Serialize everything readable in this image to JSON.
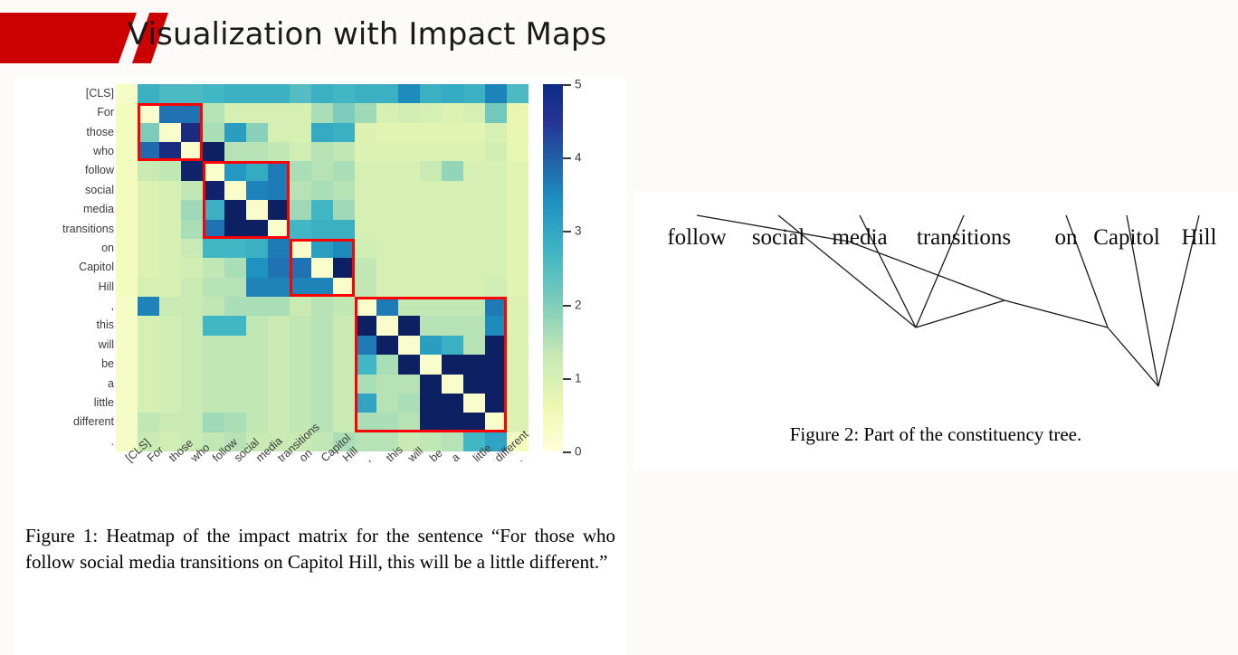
{
  "header": {
    "title": "Visualization with Impact Maps",
    "accent_color": "#cc0000"
  },
  "figure1": {
    "caption": "Figure 1: Heatmap of the impact matrix for the sentence “For those who follow social media transitions on Capitol Hill, this will be a little different.”",
    "colorbar": {
      "ticks": [
        "0",
        "1",
        "2",
        "3",
        "4",
        "5"
      ],
      "min": 0,
      "max": 5,
      "colormap": "YlGnBu"
    }
  },
  "figure2": {
    "caption": "Figure 2: Part of the constituency tree.",
    "leaves": [
      "follow",
      "social",
      "media",
      "transitions",
      "on",
      "Capitol",
      "Hill"
    ]
  },
  "chart_data": {
    "type": "heatmap",
    "title": "",
    "xlabel": "",
    "ylabel": "",
    "colormap": "YlGnBu",
    "zlim": [
      0,
      5
    ],
    "legend_position": "right",
    "grid": false,
    "x": [
      "[CLS]",
      "For",
      "those",
      "who",
      "follow",
      "social",
      "media",
      "transitions",
      "on",
      "Capitol",
      "Hill",
      ",",
      "this",
      "will",
      "be",
      "a",
      "little",
      "different",
      "."
    ],
    "y": [
      "[CLS]",
      "For",
      "those",
      "who",
      "follow",
      "social",
      "media",
      "transitions",
      "on",
      "Capitol",
      "Hill",
      ",",
      "this",
      "will",
      "be",
      "a",
      "little",
      "different",
      "."
    ],
    "annotations": [
      {
        "label": "constituent-box-1",
        "rows": [
          1,
          3
        ],
        "cols": [
          1,
          3
        ],
        "color": "#ff0000"
      },
      {
        "label": "constituent-box-2",
        "rows": [
          4,
          7
        ],
        "cols": [
          4,
          7
        ],
        "color": "#ff0000"
      },
      {
        "label": "constituent-box-3",
        "rows": [
          8,
          10
        ],
        "cols": [
          8,
          10
        ],
        "color": "#ff0000"
      },
      {
        "label": "constituent-box-4",
        "rows": [
          11,
          17
        ],
        "cols": [
          11,
          17
        ],
        "color": "#ff0000"
      }
    ],
    "values": [
      [
        0.3,
        2.6,
        2.4,
        2.4,
        2.5,
        2.6,
        2.6,
        2.6,
        2.3,
        2.6,
        2.5,
        2.6,
        2.6,
        3.2,
        2.6,
        2.7,
        2.6,
        3.3,
        2.4
      ],
      [
        0.4,
        0.2,
        3.5,
        3.5,
        1.4,
        1.0,
        1.0,
        1.0,
        1.0,
        1.5,
        1.9,
        1.6,
        1.0,
        1.1,
        1.0,
        0.9,
        1.0,
        2.0,
        0.7
      ],
      [
        0.4,
        1.9,
        0.2,
        4.6,
        1.5,
        2.9,
        1.8,
        1.0,
        1.0,
        2.7,
        2.6,
        0.9,
        0.8,
        0.8,
        0.8,
        0.8,
        0.8,
        1.0,
        0.7
      ],
      [
        0.4,
        3.6,
        4.6,
        0.2,
        4.9,
        1.4,
        1.4,
        1.3,
        1.1,
        1.4,
        1.3,
        0.9,
        0.9,
        0.9,
        0.9,
        0.9,
        0.9,
        1.1,
        0.7
      ],
      [
        0.4,
        1.2,
        1.3,
        4.8,
        0.2,
        3.0,
        2.7,
        3.4,
        1.5,
        1.4,
        1.5,
        1.0,
        1.0,
        1.0,
        1.2,
        1.7,
        1.0,
        1.0,
        0.8
      ],
      [
        0.4,
        0.9,
        1.0,
        1.3,
        4.8,
        0.2,
        3.3,
        3.4,
        1.4,
        1.5,
        1.4,
        1.0,
        1.0,
        1.0,
        1.0,
        1.0,
        1.0,
        1.0,
        0.8
      ],
      [
        0.4,
        0.9,
        1.0,
        1.6,
        2.6,
        4.9,
        0.2,
        4.9,
        1.6,
        2.5,
        1.6,
        1.0,
        1.0,
        1.0,
        1.0,
        1.0,
        1.0,
        1.0,
        0.8
      ],
      [
        0.4,
        0.9,
        1.0,
        1.5,
        3.5,
        4.9,
        4.9,
        0.2,
        2.5,
        2.6,
        2.6,
        1.0,
        1.0,
        1.0,
        1.0,
        1.0,
        1.0,
        1.0,
        0.8
      ],
      [
        0.4,
        0.9,
        1.0,
        1.2,
        2.5,
        2.5,
        2.6,
        3.4,
        0.2,
        2.9,
        3.2,
        1.1,
        1.0,
        1.0,
        1.0,
        1.0,
        1.0,
        1.0,
        0.8
      ],
      [
        0.4,
        0.9,
        1.0,
        1.1,
        1.3,
        1.5,
        3.1,
        3.5,
        3.5,
        0.2,
        4.9,
        1.3,
        1.0,
        1.0,
        1.0,
        1.0,
        1.0,
        1.0,
        0.8
      ],
      [
        0.4,
        1.0,
        1.0,
        1.2,
        1.4,
        1.4,
        3.3,
        3.3,
        3.3,
        3.3,
        0.2,
        1.3,
        1.0,
        1.0,
        1.0,
        1.0,
        1.0,
        1.1,
        0.8
      ],
      [
        0.3,
        3.3,
        1.2,
        1.2,
        1.3,
        1.5,
        1.5,
        1.5,
        1.2,
        1.4,
        1.3,
        0.2,
        3.4,
        1.3,
        1.3,
        1.3,
        1.3,
        3.4,
        0.9
      ],
      [
        0.3,
        1.0,
        1.1,
        1.2,
        2.5,
        2.5,
        1.3,
        1.2,
        1.3,
        1.4,
        1.2,
        4.9,
        0.2,
        4.9,
        1.4,
        1.4,
        1.4,
        3.2,
        0.9
      ],
      [
        0.3,
        1.0,
        1.1,
        1.2,
        1.3,
        1.3,
        1.3,
        1.2,
        1.3,
        1.4,
        1.2,
        3.4,
        4.9,
        0.2,
        2.9,
        2.6,
        1.4,
        4.9,
        0.9
      ],
      [
        0.3,
        1.0,
        1.1,
        1.2,
        1.3,
        1.3,
        1.3,
        1.2,
        1.3,
        1.4,
        1.2,
        2.5,
        1.5,
        4.9,
        0.2,
        4.9,
        4.9,
        4.9,
        0.9
      ],
      [
        0.3,
        1.0,
        1.1,
        1.2,
        1.3,
        1.3,
        1.3,
        1.2,
        1.3,
        1.4,
        1.2,
        1.5,
        1.4,
        1.4,
        4.9,
        0.2,
        4.9,
        4.9,
        0.9
      ],
      [
        0.3,
        1.0,
        1.1,
        1.2,
        1.3,
        1.3,
        1.3,
        1.2,
        1.3,
        1.4,
        1.2,
        2.8,
        1.4,
        1.5,
        4.9,
        4.9,
        0.2,
        4.9,
        0.9
      ],
      [
        0.3,
        1.3,
        1.2,
        1.2,
        1.6,
        1.5,
        1.3,
        1.2,
        1.3,
        1.4,
        1.2,
        1.5,
        1.5,
        1.4,
        4.9,
        4.9,
        4.9,
        0.2,
        0.9
      ],
      [
        0.3,
        1.2,
        1.1,
        1.2,
        1.3,
        1.4,
        1.2,
        1.2,
        1.2,
        1.3,
        1.5,
        1.4,
        1.4,
        1.2,
        1.3,
        1.4,
        2.5,
        2.8,
        0.4
      ]
    ]
  },
  "tree_data": {
    "leaves": [
      "follow",
      "social",
      "media",
      "transitions",
      "on",
      "Capitol",
      "Hill"
    ],
    "edges": [
      {
        "from": "root",
        "to": "follow"
      },
      {
        "from": "root",
        "to": "node-b"
      },
      {
        "from": "node-b",
        "to": "node-c"
      },
      {
        "from": "node-b",
        "to": "node-d"
      },
      {
        "from": "node-c",
        "to": "social"
      },
      {
        "from": "node-c",
        "to": "media"
      },
      {
        "from": "node-c",
        "to": "transitions"
      },
      {
        "from": "node-d",
        "to": "on"
      },
      {
        "from": "node-d",
        "to": "node-e"
      },
      {
        "from": "node-e",
        "to": "Capitol"
      },
      {
        "from": "node-e",
        "to": "Hill"
      }
    ]
  }
}
